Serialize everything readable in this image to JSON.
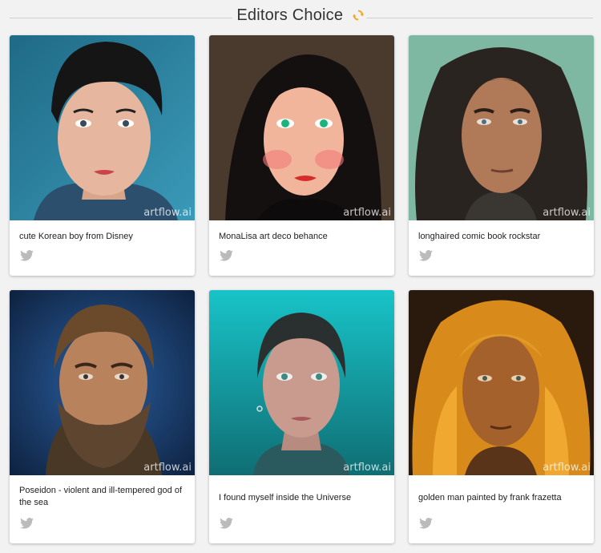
{
  "header": {
    "title": "Editors Choice",
    "refresh_icon": "refresh-icon",
    "accent": "#f5a623"
  },
  "cards": [
    {
      "caption": "cute Korean boy from Disney",
      "watermark": "artflow.ai",
      "share_icon": "twitter-icon"
    },
    {
      "caption": "MonaLisa art deco behance",
      "watermark": "artflow.ai",
      "share_icon": "twitter-icon"
    },
    {
      "caption": "longhaired comic book rockstar",
      "watermark": "artflow.ai",
      "share_icon": "twitter-icon"
    },
    {
      "caption": "Poseidon - violent and ill-tempered god of the sea",
      "watermark": "artflow.ai",
      "share_icon": "twitter-icon"
    },
    {
      "caption": "I found myself inside the Universe",
      "watermark": "artflow.ai",
      "share_icon": "twitter-icon"
    },
    {
      "caption": "golden man painted by frank frazetta",
      "watermark": "artflow.ai",
      "share_icon": "twitter-icon"
    }
  ]
}
